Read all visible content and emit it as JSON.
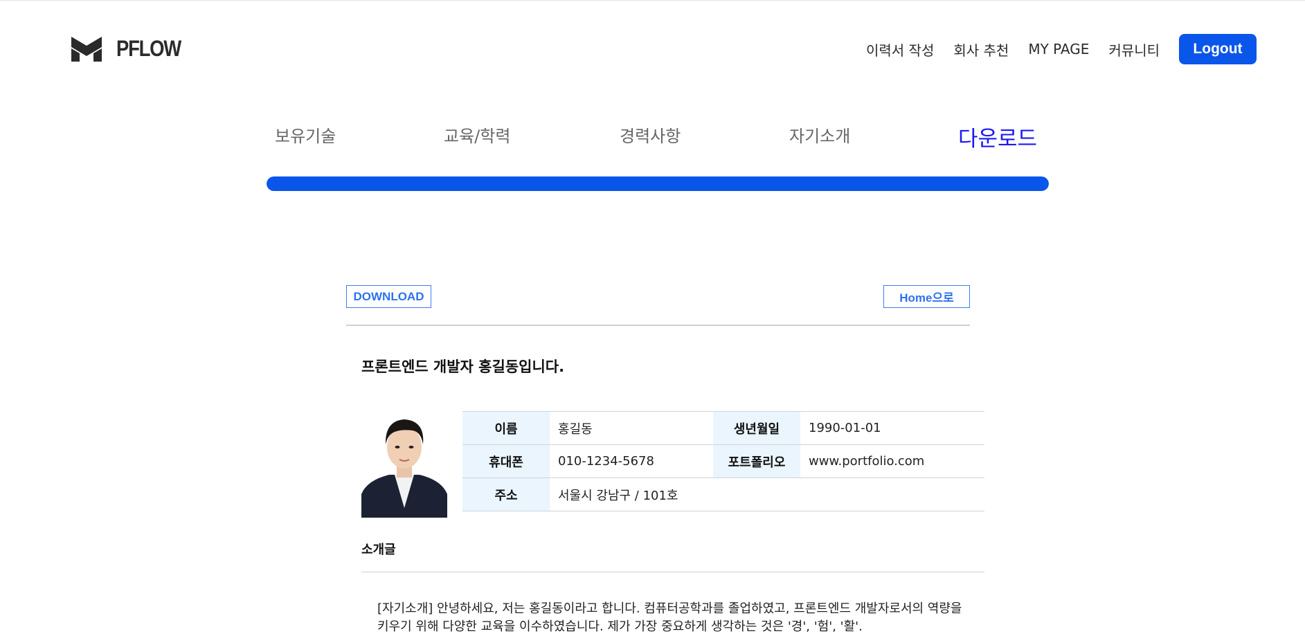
{
  "header": {
    "logo_text": "PFLOW",
    "nav": [
      "이력서 작성",
      "회사 추천",
      "MY PAGE",
      "커뮤니티"
    ],
    "logout_label": "Logout"
  },
  "steps": {
    "items": [
      "보유기술",
      "교육/학력",
      "경력사항",
      "자기소개",
      "다운로드"
    ],
    "active_index": 4,
    "progress_percent": 100,
    "progress_color": "#0a56ea",
    "active_color": "#1a18f2"
  },
  "document": {
    "download_label": "DOWNLOAD",
    "home_label": "Home으로",
    "title": "프론트엔드 개발자 홍길동입니다.",
    "info": {
      "name_label": "이름",
      "name": "홍길동",
      "birth_label": "생년월일",
      "birth": "1990-01-01",
      "phone_label": "휴대폰",
      "phone": "010-1234-5678",
      "portfolio_label": "포트폴리오",
      "portfolio": "www.portfolio.com",
      "address_label": "주소",
      "address": "서울시 강남구 / 101호"
    },
    "intro_label": "소개글",
    "intro_text": "[자기소개] 안녕하세요, 저는 홍길동이라고 합니다. 컴퓨터공학과를 졸업하였고, 프론트엔드 개발자로서의 역량을 키우기 위해 다양한 교육을 이수하였습니다. 제가 가장 중요하게 생각하는 것은 '경', '험', '활'."
  }
}
